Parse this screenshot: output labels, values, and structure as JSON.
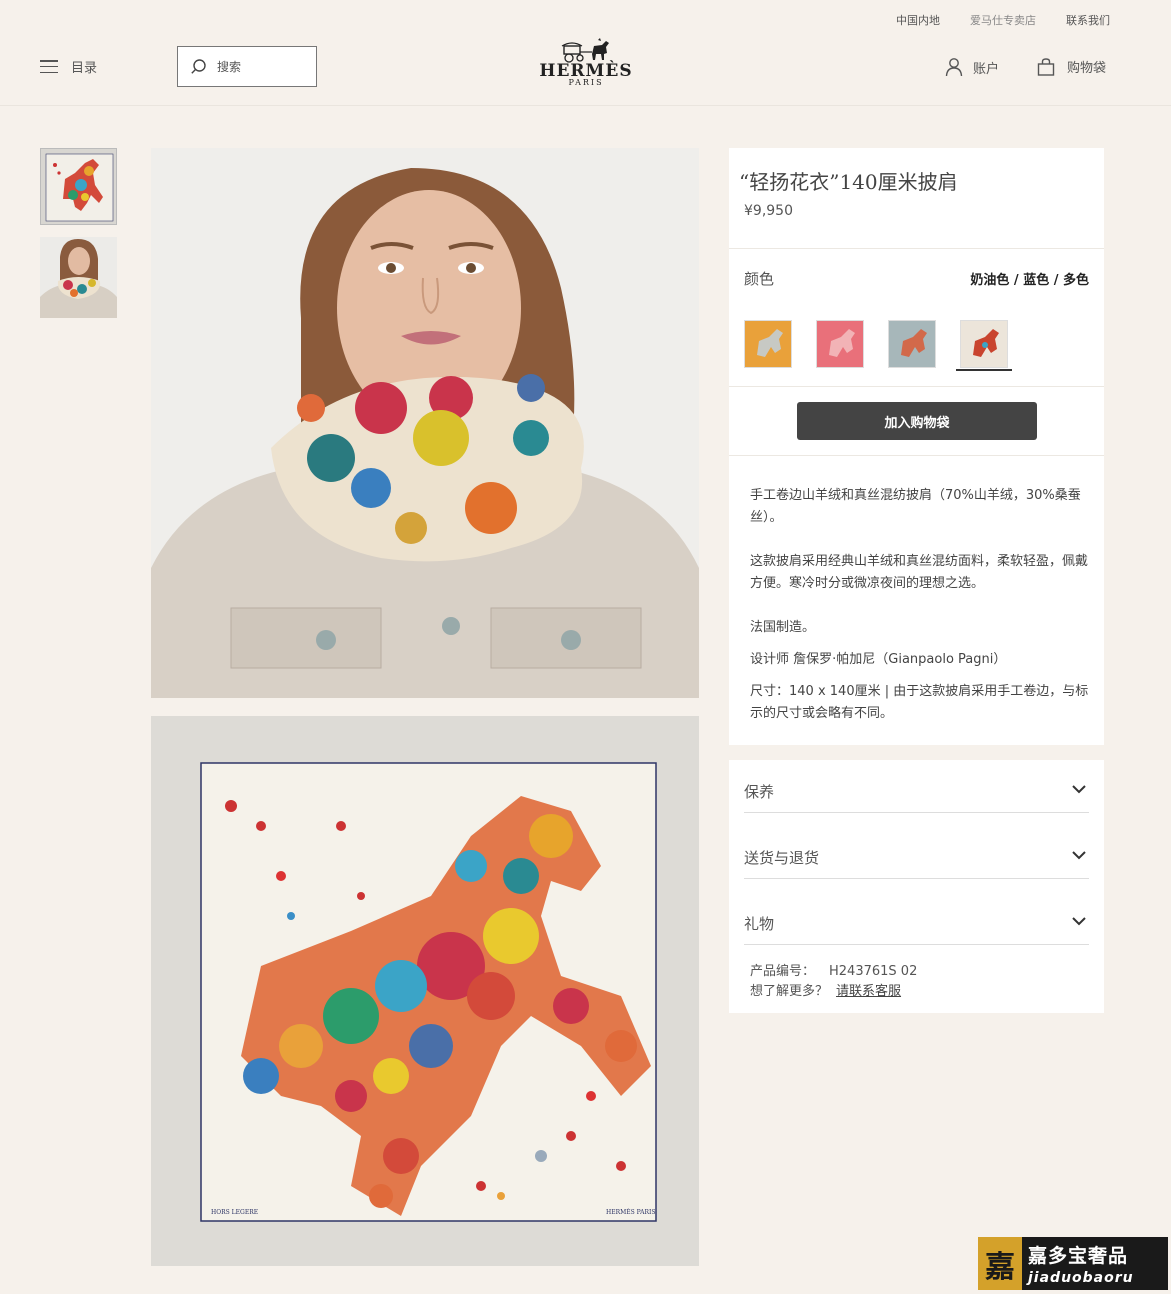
{
  "utility": {
    "region": "中国内地",
    "store": "爱马仕专卖店",
    "contact": "联系我们"
  },
  "header": {
    "menu_label": "目录",
    "search_placeholder": "搜索",
    "logo_word": "HERMÈS",
    "logo_sub": "PARIS",
    "account_label": "账户",
    "bag_label": "购物袋"
  },
  "product": {
    "title": "“轻扬花衣”140厘米披肩",
    "price": "¥9,950",
    "color_label": "颜色",
    "color_value": "奶油色 / 蓝色 / 多色",
    "swatches": [
      {
        "name": "orange",
        "bg": "#e9a13a"
      },
      {
        "name": "pink",
        "bg": "#e9707a"
      },
      {
        "name": "blue-grey",
        "bg": "#a7b7ba"
      },
      {
        "name": "cream",
        "bg": "#ece5da"
      }
    ],
    "selected_swatch": 3,
    "add_to_bag": "加入购物袋",
    "desc_1": "手工卷边山羊绒和真丝混纺披肩（70%山羊绒，30%桑蚕丝）。",
    "desc_2": "这款披肩采用经典山羊绒和真丝混纺面料，柔软轻盈，佩戴方便。寒冷时分或微凉夜间的理想之选。",
    "desc_3": "法国制造。",
    "desc_4": "设计师 詹保罗·帕加尼（Gianpaolo Pagni）",
    "desc_5": "尺寸：140 x 140厘米 | 由于这款披肩采用手工卷边，与标示的尺寸或会略有不同。"
  },
  "accordion": [
    {
      "label": "保养"
    },
    {
      "label": "送货与退货"
    },
    {
      "label": "礼物"
    }
  ],
  "sku": {
    "label": "产品编号：",
    "code": "H243761S 02"
  },
  "more": {
    "question": "想了解更多？",
    "link": "请联系客服"
  },
  "scarf_print": {
    "left": "HORS LEGERE",
    "right": "HERMÈS PARIS"
  },
  "watermark": {
    "seal": "嘉",
    "cn": "嘉多宝奢品",
    "en": "jiaduobaoru"
  }
}
